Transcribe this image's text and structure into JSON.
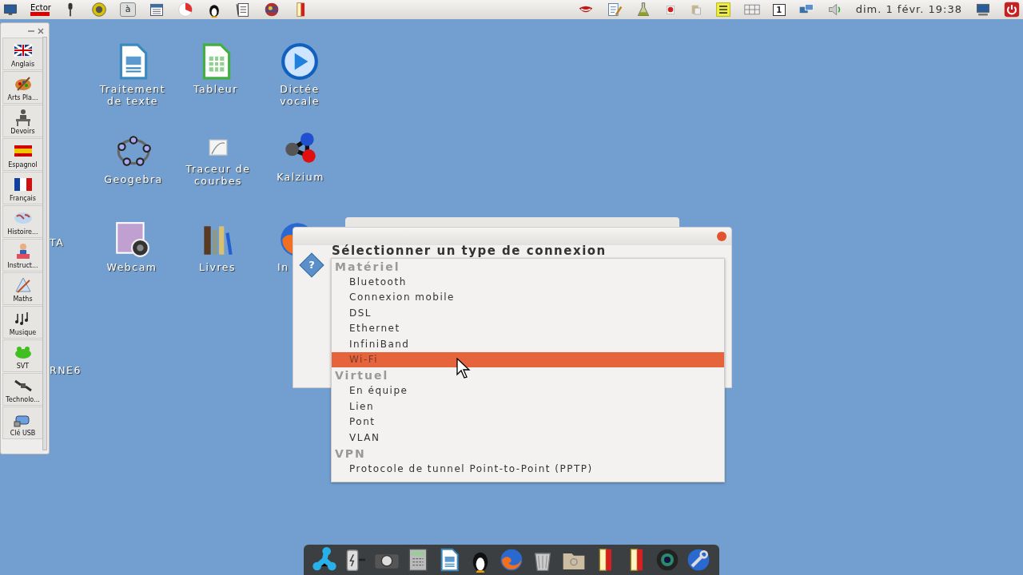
{
  "top_panel": {
    "left_items": [
      {
        "kind": "label",
        "text": "Ector"
      },
      {
        "kind": "key",
        "text": "à"
      }
    ],
    "right_items": [
      {
        "kind": "workspace",
        "text": "1"
      }
    ],
    "clock": "dim. 1 févr. 19:38"
  },
  "sidebar": {
    "items": [
      {
        "label": "Anglais"
      },
      {
        "label": "Arts Pla..."
      },
      {
        "label": "Devoirs"
      },
      {
        "label": "Espagnol"
      },
      {
        "label": "Français"
      },
      {
        "label": "Histoire..."
      },
      {
        "label": "Instruct..."
      },
      {
        "label": "Maths"
      },
      {
        "label": "Musique"
      },
      {
        "label": "SVT"
      },
      {
        "label": "Technolo..."
      },
      {
        "label": "Clé USB"
      }
    ]
  },
  "desktop": {
    "icons": [
      {
        "label": "Traitement de texte"
      },
      {
        "label": "Tableur"
      },
      {
        "label": "Dictée vocale"
      },
      {
        "label": "Geogebra"
      },
      {
        "label": "Traceur de courbes"
      },
      {
        "label": "Kalzium"
      },
      {
        "label": "Webcam"
      },
      {
        "label": "Livres"
      },
      {
        "label": "In"
      }
    ],
    "partial_labels": [
      {
        "text": "TA"
      },
      {
        "text": "RNE6"
      }
    ]
  },
  "dialog": {
    "icon": "?",
    "title": "Sélectionner un type de connexion"
  },
  "dropdown": {
    "groups": [
      {
        "header": "Matériel",
        "items": [
          {
            "label": "Bluetooth",
            "selected": false
          },
          {
            "label": "Connexion mobile",
            "selected": false
          },
          {
            "label": "DSL",
            "selected": false
          },
          {
            "label": "Ethernet",
            "selected": false
          },
          {
            "label": "InfiniBand",
            "selected": false
          },
          {
            "label": "Wi-Fi",
            "selected": true
          }
        ]
      },
      {
        "header": "Virtuel",
        "items": [
          {
            "label": "En équipe",
            "selected": false
          },
          {
            "label": "Lien",
            "selected": false
          },
          {
            "label": "Pont",
            "selected": false
          },
          {
            "label": "VLAN",
            "selected": false
          }
        ]
      },
      {
        "header": "VPN",
        "items": [
          {
            "label": "Protocole de tunnel Point-to-Point (PPTP)",
            "selected": false
          }
        ]
      }
    ]
  }
}
